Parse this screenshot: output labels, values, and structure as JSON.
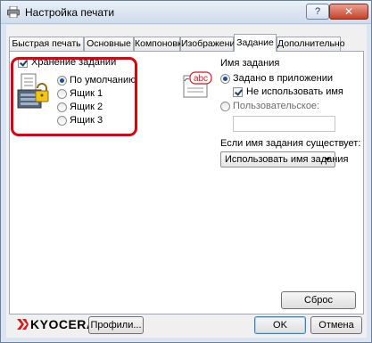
{
  "window": {
    "title": "Настройка печати",
    "help_label": "?",
    "close_label": "✕"
  },
  "tabs": [
    {
      "label": "Быстрая печать",
      "active": false
    },
    {
      "label": "Основные",
      "active": false
    },
    {
      "label": "Компоновка",
      "active": false
    },
    {
      "label": "Изображения",
      "active": false
    },
    {
      "label": "Задание",
      "active": true
    },
    {
      "label": "Дополнительно",
      "active": false
    }
  ],
  "job_storage": {
    "checkbox_label": "Хранение заданий",
    "checked": true,
    "options": [
      {
        "label": "По умолчанию",
        "selected": true
      },
      {
        "label": "Ящик 1",
        "selected": false
      },
      {
        "label": "Ящик 2",
        "selected": false
      },
      {
        "label": "Ящик 3",
        "selected": false
      }
    ]
  },
  "job_name": {
    "heading": "Имя задания",
    "icon_text": "abc",
    "option_app": "Задано в приложении",
    "option_app_selected": true,
    "dont_use_name_label": "Не использовать имя",
    "dont_use_name_checked": true,
    "option_custom": "Пользовательское:",
    "option_custom_selected": false,
    "custom_value": "",
    "exists_label": "Если имя задания существует:",
    "exists_selected": "Использовать имя задания"
  },
  "reset_label": "Сброс",
  "footer": {
    "brand": "KYOCERA",
    "profiles_label": "Профили...",
    "ok_label": "OK",
    "cancel_label": "Отмена"
  },
  "colors": {
    "brand_red": "#d7181f",
    "highlight": "#e0000f"
  }
}
